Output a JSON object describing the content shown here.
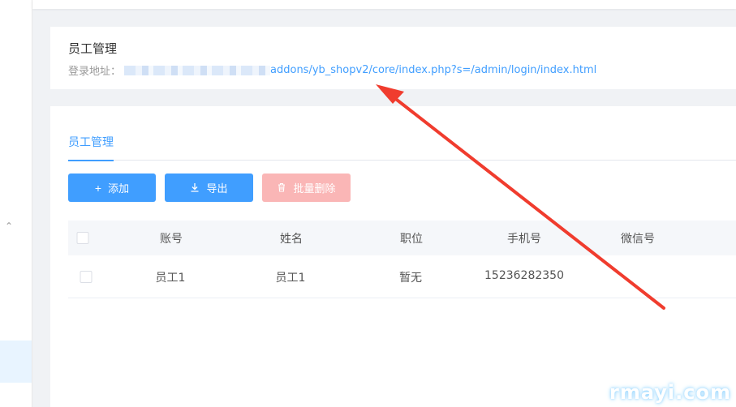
{
  "info": {
    "title": "员工管理",
    "login_label": "登录地址：",
    "login_url": "addons/yb_shopv2/core/index.php?s=/admin/login/index.html"
  },
  "tabs": [
    {
      "label": "员工管理"
    }
  ],
  "toolbar": {
    "add_label": "添加",
    "export_label": "导出",
    "batch_delete_label": "批量删除"
  },
  "table": {
    "headers": [
      "账号",
      "姓名",
      "职位",
      "手机号",
      "微信号"
    ],
    "rows": [
      {
        "account": "员工1",
        "name": "员工1",
        "position": "暂无",
        "phone": "15236282350",
        "wechat": ""
      }
    ]
  },
  "watermark": "rmayi.com",
  "colors": {
    "primary": "#409eff",
    "danger_disabled": "#fab6b6",
    "arrow": "#f03c2e"
  },
  "icons": {
    "add": "plus-icon",
    "export": "download-icon",
    "delete": "trash-icon",
    "sidebar_toggle": "chevron-up-icon"
  }
}
